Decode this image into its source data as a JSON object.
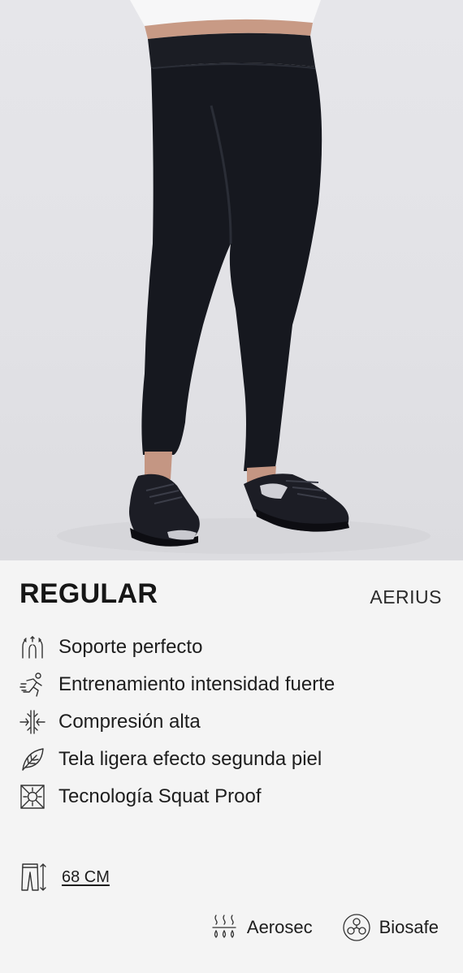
{
  "product": {
    "fit_title": "REGULAR",
    "brand": "AERIUS",
    "features": [
      {
        "icon": "support-icon",
        "label": "Soporte perfecto"
      },
      {
        "icon": "runner-icon",
        "label": "Entrenamiento intensidad fuerte"
      },
      {
        "icon": "compression-icon",
        "label": "Compresión alta"
      },
      {
        "icon": "leaf-icon",
        "label": "Tela ligera efecto segunda piel"
      },
      {
        "icon": "squat-proof-icon",
        "label": "Tecnología Squat Proof"
      }
    ],
    "length": {
      "icon": "leggings-length-icon",
      "label": "68 CM"
    },
    "technologies": [
      {
        "icon": "aerosec-icon",
        "label": "Aerosec"
      },
      {
        "icon": "biosafe-icon",
        "label": "Biosafe"
      }
    ]
  },
  "colors": {
    "background": "#f4f4f4",
    "text": "#1a1a1a",
    "legging": "#16181f"
  }
}
